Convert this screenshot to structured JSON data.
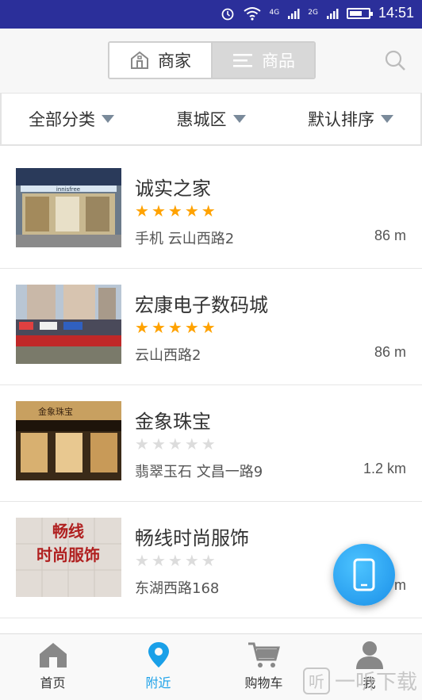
{
  "status_bar": {
    "time": "14:51",
    "network_labels": [
      "4G",
      "2G"
    ],
    "battery_level": 0.7,
    "icons": [
      "alarm-icon",
      "wifi-icon",
      "signal-icon",
      "battery-icon"
    ]
  },
  "header": {
    "segments": [
      {
        "label": "商家",
        "icon": "shop-icon",
        "active": true
      },
      {
        "label": "商品",
        "icon": "list-icon",
        "active": false
      }
    ],
    "search_icon": "search-icon"
  },
  "filters": [
    {
      "label": "全部分类"
    },
    {
      "label": "惠城区"
    },
    {
      "label": "默认排序"
    }
  ],
  "stores": [
    {
      "name": "诚实之家",
      "rating": 5,
      "address": "手机  云山西路2",
      "distance": "86 m",
      "thumb_sign": "innisfree"
    },
    {
      "name": "宏康电子数码城",
      "rating": 5,
      "address": " 云山西路2",
      "distance": "86 m"
    },
    {
      "name": "金象珠宝",
      "rating": 0,
      "address": "翡翠玉石  文昌一路9",
      "distance": "1.2 km",
      "thumb_sign": "金象珠宝"
    },
    {
      "name": "畅线时尚服饰",
      "rating": 0,
      "address": " 东湖西路168",
      "distance": "m",
      "thumb_sign": "畅线时尚服饰"
    }
  ],
  "fab": {
    "icon": "phone-icon"
  },
  "tabs": [
    {
      "label": "首页",
      "icon": "home-icon",
      "active": false
    },
    {
      "label": "附近",
      "icon": "location-pin-icon",
      "active": true
    },
    {
      "label": "购物车",
      "icon": "cart-icon",
      "active": false
    },
    {
      "label": "我",
      "icon": "user-icon",
      "active": false
    }
  ],
  "watermark": {
    "text": "一听下载",
    "glyph": "听"
  },
  "colors": {
    "status_bar": "#2b2f9a",
    "star_on": "#ffa200",
    "star_off": "#dcdcdc",
    "accent": "#1aa0e8"
  }
}
